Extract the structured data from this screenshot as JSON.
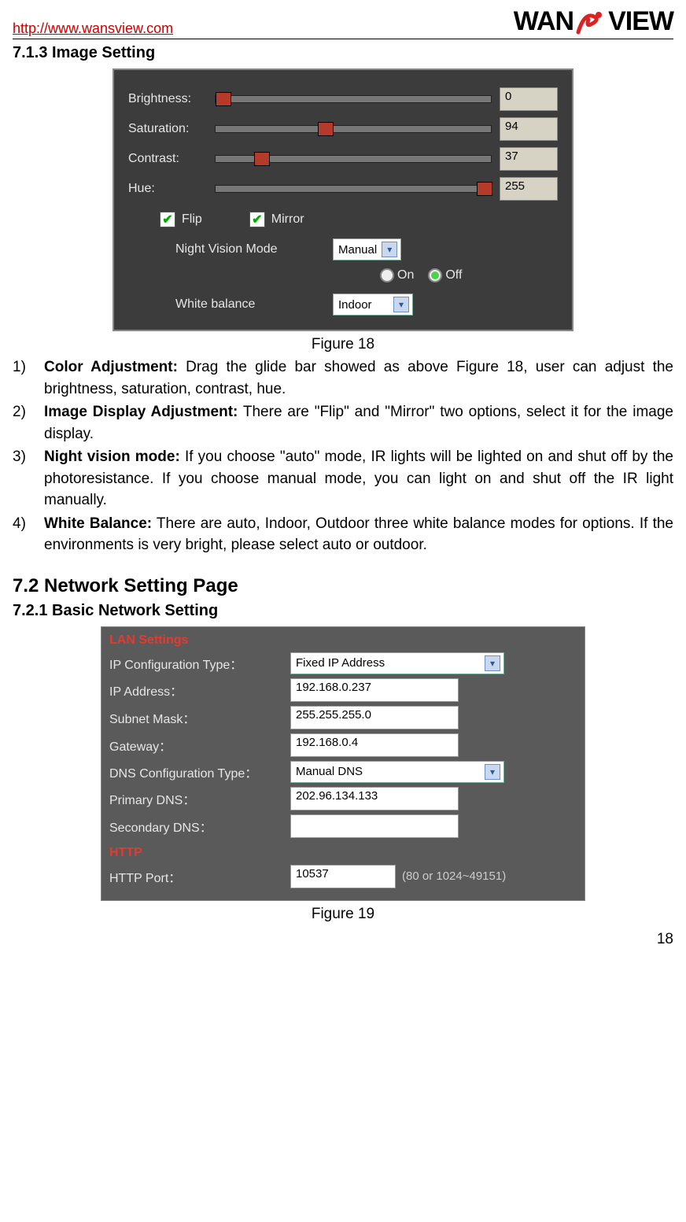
{
  "header": {
    "url": "http://www.wansview.com",
    "brand_left": "WAN",
    "brand_right": "VIEW"
  },
  "section713": "7.1.3   Image Setting",
  "fig18": {
    "caption": "Figure 18",
    "sliders": {
      "brightness": {
        "label": "Brightness:",
        "value": "0",
        "pct": 0
      },
      "saturation": {
        "label": "Saturation:",
        "value": "94",
        "pct": 37
      },
      "contrast": {
        "label": "Contrast:",
        "value": "37",
        "pct": 14
      },
      "hue": {
        "label": "Hue:",
        "value": "255",
        "pct": 100
      }
    },
    "flip_label": "Flip",
    "mirror_label": "Mirror",
    "night_label": "Night Vision Mode",
    "night_select": "Manual",
    "radio_on": "On",
    "radio_off": "Off",
    "wb_label": "White balance",
    "wb_select": "Indoor"
  },
  "list18": {
    "n1": "1)",
    "t1a": "Color Adjustment:",
    "t1b": " Drag the glide bar showed as above Figure 18, user can adjust the brightness, saturation, contrast, hue.",
    "n2": "2)",
    "t2a": "Image Display Adjustment:",
    "t2b": " There are \"Flip\" and \"Mirror\" two options, select it for the image display.",
    "n3": "3)",
    "t3a": "Night vision mode:",
    "t3b": " If you choose \"auto\" mode, IR lights will be lighted on and shut off by the photoresistance. If you choose manual mode, you can light on and shut off the IR light manually.",
    "n4": "4)",
    "t4a": "White Balance:",
    "t4b": " There are auto, Indoor, Outdoor three white balance modes for options. If the environments is very bright, please select auto or outdoor."
  },
  "section72": "7.2   Network Setting Page",
  "section721": "7.2.1   Basic Network Setting",
  "fig19": {
    "caption": "Figure 19",
    "lan_header": "LAN Settings",
    "rows": {
      "ipconf": {
        "label": "IP Configuration Type：",
        "value": "Fixed IP Address"
      },
      "ip": {
        "label": "IP Address：",
        "value": "192.168.0.237"
      },
      "mask": {
        "label": "Subnet Mask：",
        "value": "255.255.255.0"
      },
      "gw": {
        "label": "Gateway：",
        "value": "192.168.0.4"
      },
      "dnsconf": {
        "label": "DNS Configuration Type：",
        "value": "Manual DNS"
      },
      "dns1": {
        "label": "Primary DNS：",
        "value": "202.96.134.133"
      },
      "dns2": {
        "label": "Secondary DNS：",
        "value": ""
      }
    },
    "http_header": "HTTP",
    "http_label": "HTTP Port：",
    "http_value": "10537",
    "http_note": "(80 or 1024~49151)"
  },
  "page_number": "18"
}
